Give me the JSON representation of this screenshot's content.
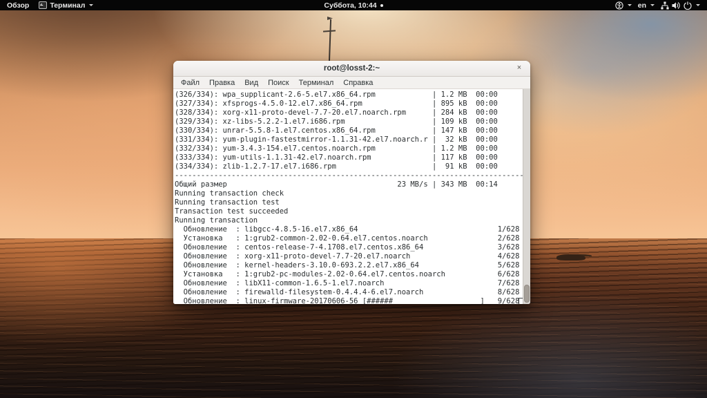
{
  "top_bar": {
    "activities_label": "Обзор",
    "app_menu_label": "Терминал",
    "clock": "Суббота, 10:44",
    "keyboard_layout": "en"
  },
  "window": {
    "title": "root@losst-2:~",
    "close_label": "×",
    "menus": [
      "Файл",
      "Правка",
      "Вид",
      "Поиск",
      "Терминал",
      "Справка"
    ]
  },
  "terminal": {
    "lines": [
      "(326/334): wpa_supplicant-2.6-5.el7.x86_64.rpm             | 1.2 MB  00:00",
      "(327/334): xfsprogs-4.5.0-12.el7.x86_64.rpm                | 895 kB  00:00",
      "(328/334): xorg-x11-proto-devel-7.7-20.el7.noarch.rpm      | 284 kB  00:00",
      "(329/334): xz-libs-5.2.2-1.el7.i686.rpm                    | 109 kB  00:00",
      "(330/334): unrar-5.5.8-1.el7.centos.x86_64.rpm             | 147 kB  00:00",
      "(331/334): yum-plugin-fastestmirror-1.1.31-42.el7.noarch.r |  32 kB  00:00",
      "(332/334): yum-3.4.3-154.el7.centos.noarch.rpm             | 1.2 MB  00:00",
      "(333/334): yum-utils-1.1.31-42.el7.noarch.rpm              | 117 kB  00:00",
      "(334/334): zlib-1.2.7-17.el7.i686.rpm                      |  91 kB  00:00",
      "--------------------------------------------------------------------------------",
      "Общий размер                                       23 MB/s | 343 MB  00:14",
      "Running transaction check",
      "Running transaction test",
      "Transaction test succeeded",
      "Running transaction",
      "  Обновление  : libgcc-4.8.5-16.el7.x86_64                                1/628",
      "  Установка   : 1:grub2-common-2.02-0.64.el7.centos.noarch                2/628",
      "  Обновление  : centos-release-7-4.1708.el7.centos.x86_64                 3/628",
      "  Обновление  : xorg-x11-proto-devel-7.7-20.el7.noarch                    4/628",
      "  Обновление  : kernel-headers-3.10.0-693.2.2.el7.x86_64                  5/628",
      "  Установка   : 1:grub2-pc-modules-2.02-0.64.el7.centos.noarch            6/628",
      "  Обновление  : libX11-common-1.6.5-1.el7.noarch                          7/628",
      "  Обновление  : firewalld-filesystem-0.4.4.4-6.el7.noarch                 8/628",
      "  Обновление  : linux-firmware-20170606-56 [######                    ]   9/628"
    ]
  },
  "colors": {
    "top_bar_bg": "#060606",
    "terminal_bg": "#ffffff",
    "terminal_text": "#2a2e30",
    "titlebar_bg": "#f3f1ef"
  }
}
